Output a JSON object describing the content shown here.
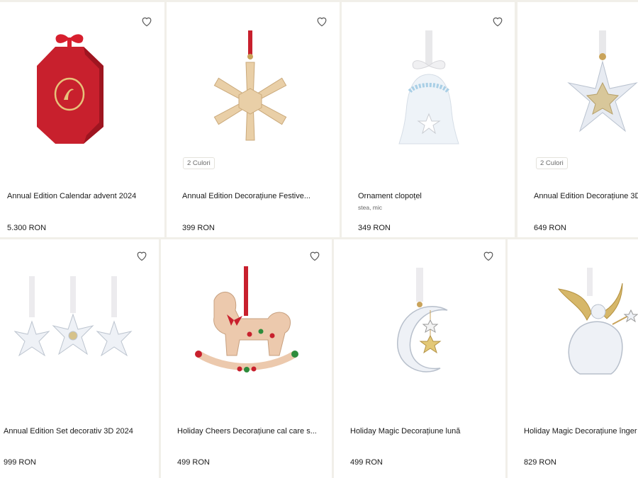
{
  "products": [
    {
      "title": "Annual Edition Calendar advent 2024",
      "price": "5.300 RON",
      "icon": "advent-calendar-box"
    },
    {
      "title": "Annual Edition Decorațiune Festive...",
      "price": "399 RON",
      "badge": "2 Culori",
      "icon": "golden-snowflake-ornament"
    },
    {
      "title": "Ornament clopoțel",
      "subtitle": "stea, mic",
      "price": "349 RON",
      "icon": "bell-ornament"
    },
    {
      "title": "Annual Edition Decorațiune 3D",
      "price": "649 RON",
      "badge": "2 Culori",
      "icon": "crystal-3d-star-ornament"
    },
    {
      "title": "Annual Edition Set decorativ 3D 2024",
      "price": "999 RON",
      "icon": "three-snowflake-set"
    },
    {
      "title": "Holiday Cheers Decorațiune cal care s...",
      "price": "499 RON",
      "icon": "rocking-horse-ornament"
    },
    {
      "title": "Holiday Magic Decorațiune lună",
      "price": "499 RON",
      "icon": "crescent-moon-ornament"
    },
    {
      "title": "Holiday Magic Decorațiune înger",
      "price": "829 RON",
      "icon": "angel-ornament"
    }
  ],
  "wishlist_icon": "heart-outline-icon",
  "colors": {
    "background": "#f1efe9",
    "card": "#ffffff",
    "red": "#c8202d",
    "gold": "#c9a35a"
  }
}
